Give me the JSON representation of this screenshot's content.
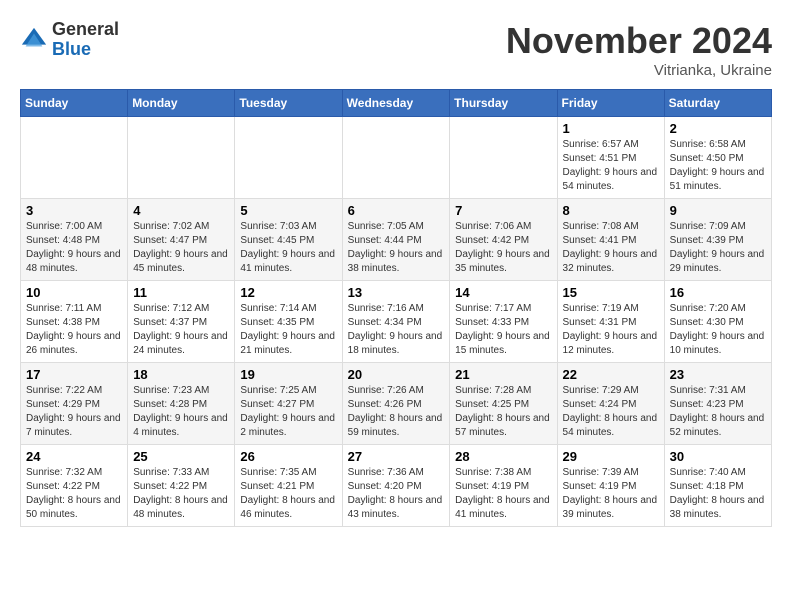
{
  "logo": {
    "general": "General",
    "blue": "Blue"
  },
  "title": "November 2024",
  "subtitle": "Vitrianka, Ukraine",
  "days_of_week": [
    "Sunday",
    "Monday",
    "Tuesday",
    "Wednesday",
    "Thursday",
    "Friday",
    "Saturday"
  ],
  "weeks": [
    [
      null,
      null,
      null,
      null,
      null,
      {
        "day": "1",
        "sunrise": "Sunrise: 6:57 AM",
        "sunset": "Sunset: 4:51 PM",
        "daylight": "Daylight: 9 hours and 54 minutes."
      },
      {
        "day": "2",
        "sunrise": "Sunrise: 6:58 AM",
        "sunset": "Sunset: 4:50 PM",
        "daylight": "Daylight: 9 hours and 51 minutes."
      }
    ],
    [
      {
        "day": "3",
        "sunrise": "Sunrise: 7:00 AM",
        "sunset": "Sunset: 4:48 PM",
        "daylight": "Daylight: 9 hours and 48 minutes."
      },
      {
        "day": "4",
        "sunrise": "Sunrise: 7:02 AM",
        "sunset": "Sunset: 4:47 PM",
        "daylight": "Daylight: 9 hours and 45 minutes."
      },
      {
        "day": "5",
        "sunrise": "Sunrise: 7:03 AM",
        "sunset": "Sunset: 4:45 PM",
        "daylight": "Daylight: 9 hours and 41 minutes."
      },
      {
        "day": "6",
        "sunrise": "Sunrise: 7:05 AM",
        "sunset": "Sunset: 4:44 PM",
        "daylight": "Daylight: 9 hours and 38 minutes."
      },
      {
        "day": "7",
        "sunrise": "Sunrise: 7:06 AM",
        "sunset": "Sunset: 4:42 PM",
        "daylight": "Daylight: 9 hours and 35 minutes."
      },
      {
        "day": "8",
        "sunrise": "Sunrise: 7:08 AM",
        "sunset": "Sunset: 4:41 PM",
        "daylight": "Daylight: 9 hours and 32 minutes."
      },
      {
        "day": "9",
        "sunrise": "Sunrise: 7:09 AM",
        "sunset": "Sunset: 4:39 PM",
        "daylight": "Daylight: 9 hours and 29 minutes."
      }
    ],
    [
      {
        "day": "10",
        "sunrise": "Sunrise: 7:11 AM",
        "sunset": "Sunset: 4:38 PM",
        "daylight": "Daylight: 9 hours and 26 minutes."
      },
      {
        "day": "11",
        "sunrise": "Sunrise: 7:12 AM",
        "sunset": "Sunset: 4:37 PM",
        "daylight": "Daylight: 9 hours and 24 minutes."
      },
      {
        "day": "12",
        "sunrise": "Sunrise: 7:14 AM",
        "sunset": "Sunset: 4:35 PM",
        "daylight": "Daylight: 9 hours and 21 minutes."
      },
      {
        "day": "13",
        "sunrise": "Sunrise: 7:16 AM",
        "sunset": "Sunset: 4:34 PM",
        "daylight": "Daylight: 9 hours and 18 minutes."
      },
      {
        "day": "14",
        "sunrise": "Sunrise: 7:17 AM",
        "sunset": "Sunset: 4:33 PM",
        "daylight": "Daylight: 9 hours and 15 minutes."
      },
      {
        "day": "15",
        "sunrise": "Sunrise: 7:19 AM",
        "sunset": "Sunset: 4:31 PM",
        "daylight": "Daylight: 9 hours and 12 minutes."
      },
      {
        "day": "16",
        "sunrise": "Sunrise: 7:20 AM",
        "sunset": "Sunset: 4:30 PM",
        "daylight": "Daylight: 9 hours and 10 minutes."
      }
    ],
    [
      {
        "day": "17",
        "sunrise": "Sunrise: 7:22 AM",
        "sunset": "Sunset: 4:29 PM",
        "daylight": "Daylight: 9 hours and 7 minutes."
      },
      {
        "day": "18",
        "sunrise": "Sunrise: 7:23 AM",
        "sunset": "Sunset: 4:28 PM",
        "daylight": "Daylight: 9 hours and 4 minutes."
      },
      {
        "day": "19",
        "sunrise": "Sunrise: 7:25 AM",
        "sunset": "Sunset: 4:27 PM",
        "daylight": "Daylight: 9 hours and 2 minutes."
      },
      {
        "day": "20",
        "sunrise": "Sunrise: 7:26 AM",
        "sunset": "Sunset: 4:26 PM",
        "daylight": "Daylight: 8 hours and 59 minutes."
      },
      {
        "day": "21",
        "sunrise": "Sunrise: 7:28 AM",
        "sunset": "Sunset: 4:25 PM",
        "daylight": "Daylight: 8 hours and 57 minutes."
      },
      {
        "day": "22",
        "sunrise": "Sunrise: 7:29 AM",
        "sunset": "Sunset: 4:24 PM",
        "daylight": "Daylight: 8 hours and 54 minutes."
      },
      {
        "day": "23",
        "sunrise": "Sunrise: 7:31 AM",
        "sunset": "Sunset: 4:23 PM",
        "daylight": "Daylight: 8 hours and 52 minutes."
      }
    ],
    [
      {
        "day": "24",
        "sunrise": "Sunrise: 7:32 AM",
        "sunset": "Sunset: 4:22 PM",
        "daylight": "Daylight: 8 hours and 50 minutes."
      },
      {
        "day": "25",
        "sunrise": "Sunrise: 7:33 AM",
        "sunset": "Sunset: 4:22 PM",
        "daylight": "Daylight: 8 hours and 48 minutes."
      },
      {
        "day": "26",
        "sunrise": "Sunrise: 7:35 AM",
        "sunset": "Sunset: 4:21 PM",
        "daylight": "Daylight: 8 hours and 46 minutes."
      },
      {
        "day": "27",
        "sunrise": "Sunrise: 7:36 AM",
        "sunset": "Sunset: 4:20 PM",
        "daylight": "Daylight: 8 hours and 43 minutes."
      },
      {
        "day": "28",
        "sunrise": "Sunrise: 7:38 AM",
        "sunset": "Sunset: 4:19 PM",
        "daylight": "Daylight: 8 hours and 41 minutes."
      },
      {
        "day": "29",
        "sunrise": "Sunrise: 7:39 AM",
        "sunset": "Sunset: 4:19 PM",
        "daylight": "Daylight: 8 hours and 39 minutes."
      },
      {
        "day": "30",
        "sunrise": "Sunrise: 7:40 AM",
        "sunset": "Sunset: 4:18 PM",
        "daylight": "Daylight: 8 hours and 38 minutes."
      }
    ]
  ]
}
